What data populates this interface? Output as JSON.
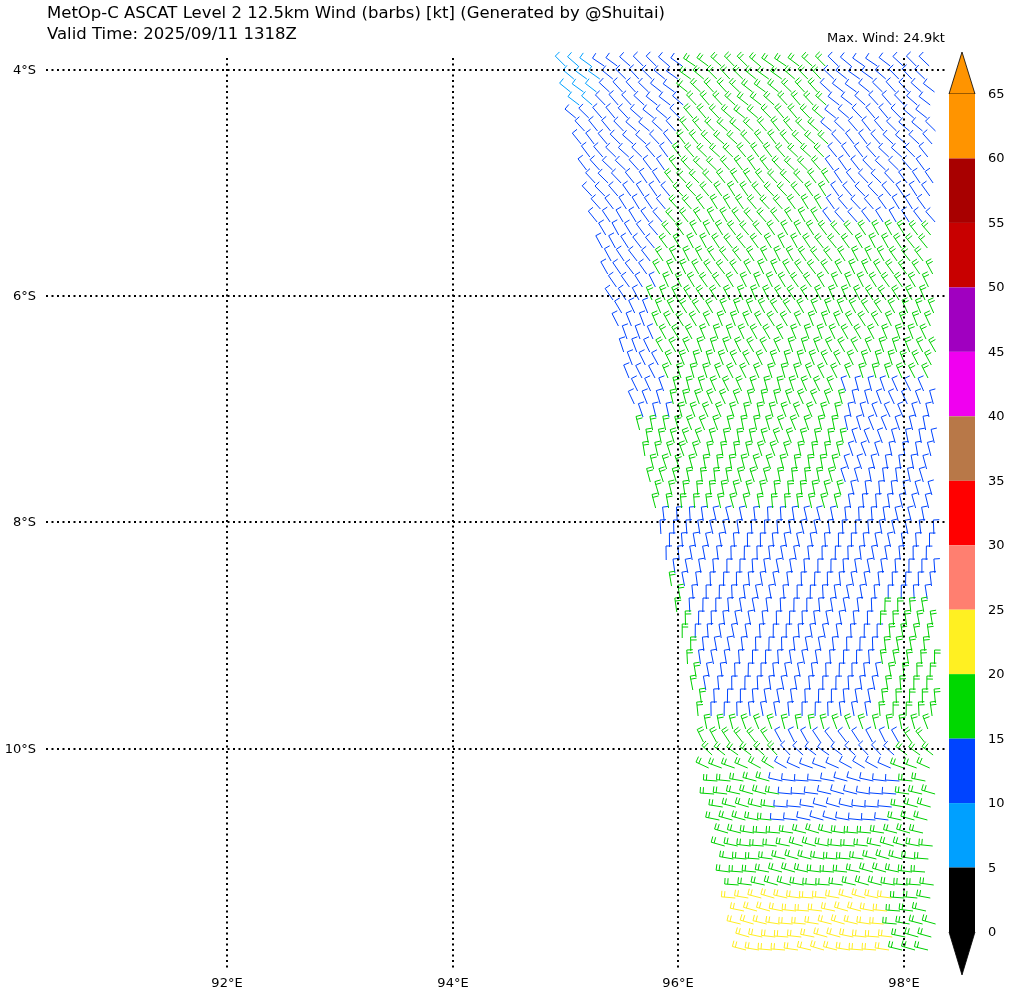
{
  "title": "MetOp-C ASCAT Level 2 12.5km Wind (barbs) [kt] (Generated by @Shuitai)",
  "valid_time": "Valid Time: 2025/09/11 1318Z",
  "max_wind": "Max. Wind: 24.9kt",
  "latitude_labels": [
    "4°S",
    "6°S",
    "8°S",
    "10°S"
  ],
  "longitude_labels": [
    "92°E",
    "94°E",
    "96°E",
    "98°E"
  ],
  "colorbar": {
    "labels": [
      "65",
      "60",
      "55",
      "50",
      "45",
      "40",
      "35",
      "30",
      "25",
      "20",
      "15",
      "10",
      "5",
      "0"
    ],
    "segments": [
      {
        "color": "#ff9400"
      },
      {
        "color": "#a80000"
      },
      {
        "color": "#c80000"
      },
      {
        "color": "#a000c0"
      },
      {
        "color": "#f000f0"
      },
      {
        "color": "#b87848"
      },
      {
        "color": "#ff0000"
      },
      {
        "color": "#ff7f70"
      },
      {
        "color": "#fff022"
      },
      {
        "color": "#00d800"
      },
      {
        "color": "#0044ff"
      },
      {
        "color": "#00a0ff"
      },
      {
        "color": "#000000"
      }
    ]
  }
}
